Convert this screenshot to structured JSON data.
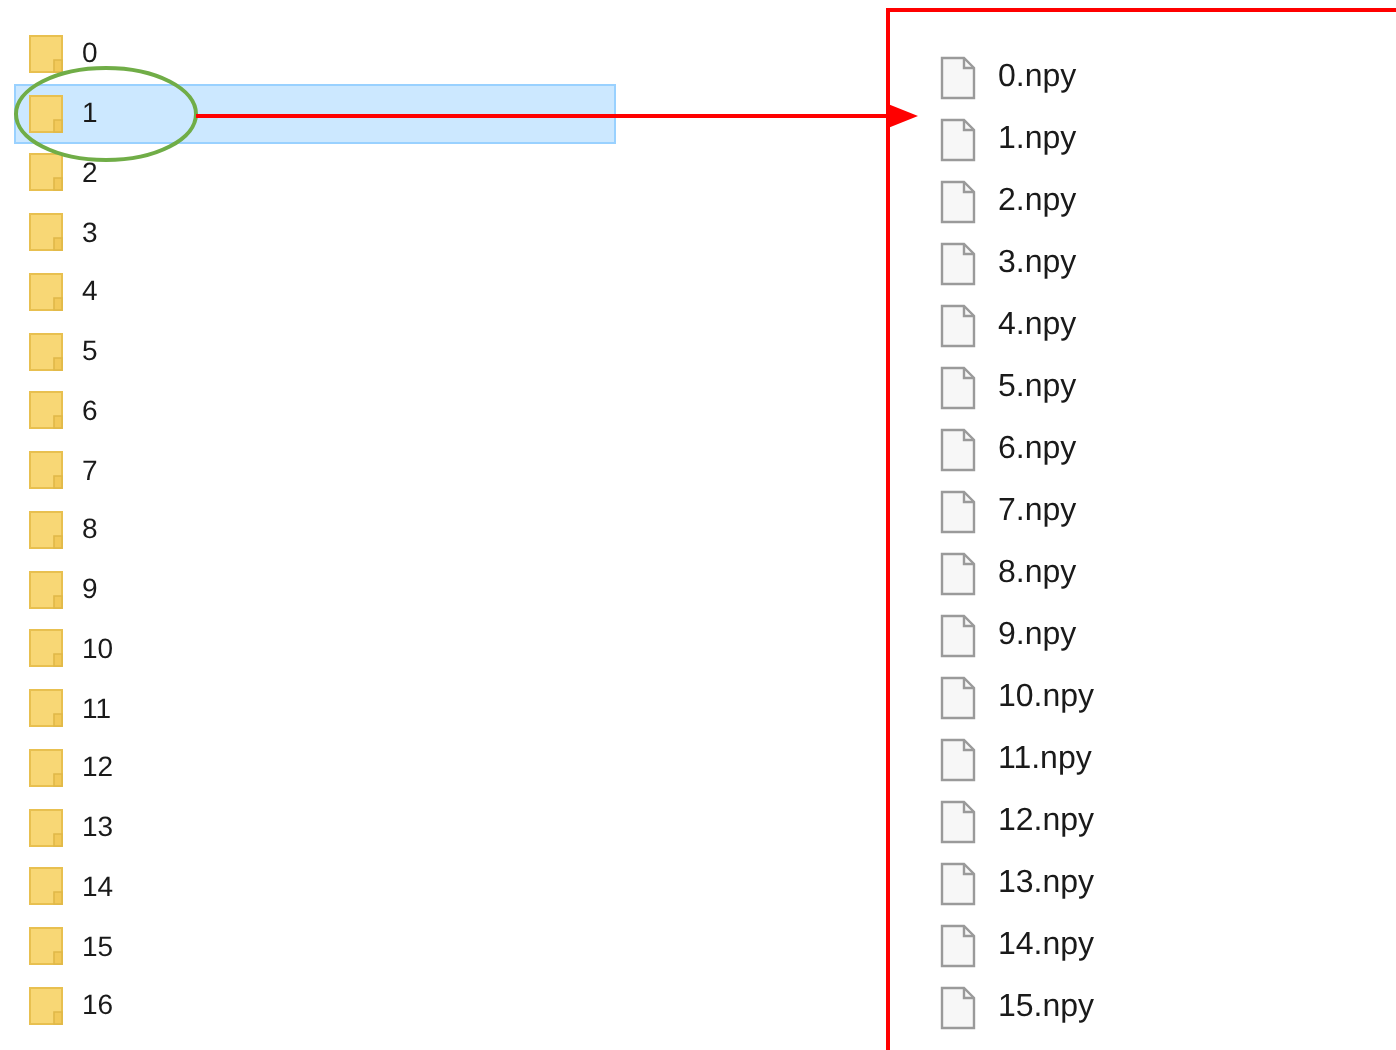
{
  "folders": [
    {
      "name": "0",
      "selected": false
    },
    {
      "name": "1",
      "selected": true
    },
    {
      "name": "2",
      "selected": false
    },
    {
      "name": "3",
      "selected": false
    },
    {
      "name": "4",
      "selected": false
    },
    {
      "name": "5",
      "selected": false
    },
    {
      "name": "6",
      "selected": false
    },
    {
      "name": "7",
      "selected": false
    },
    {
      "name": "8",
      "selected": false
    },
    {
      "name": "9",
      "selected": false
    },
    {
      "name": "10",
      "selected": false
    },
    {
      "name": "11",
      "selected": false
    },
    {
      "name": "12",
      "selected": false
    },
    {
      "name": "13",
      "selected": false
    },
    {
      "name": "14",
      "selected": false
    },
    {
      "name": "15",
      "selected": false
    },
    {
      "name": "16",
      "selected": false
    }
  ],
  "files": [
    "0.npy",
    "1.npy",
    "2.npy",
    "3.npy",
    "4.npy",
    "5.npy",
    "6.npy",
    "7.npy",
    "8.npy",
    "9.npy",
    "10.npy",
    "11.npy",
    "12.npy",
    "13.npy",
    "14.npy",
    "15.npy"
  ]
}
